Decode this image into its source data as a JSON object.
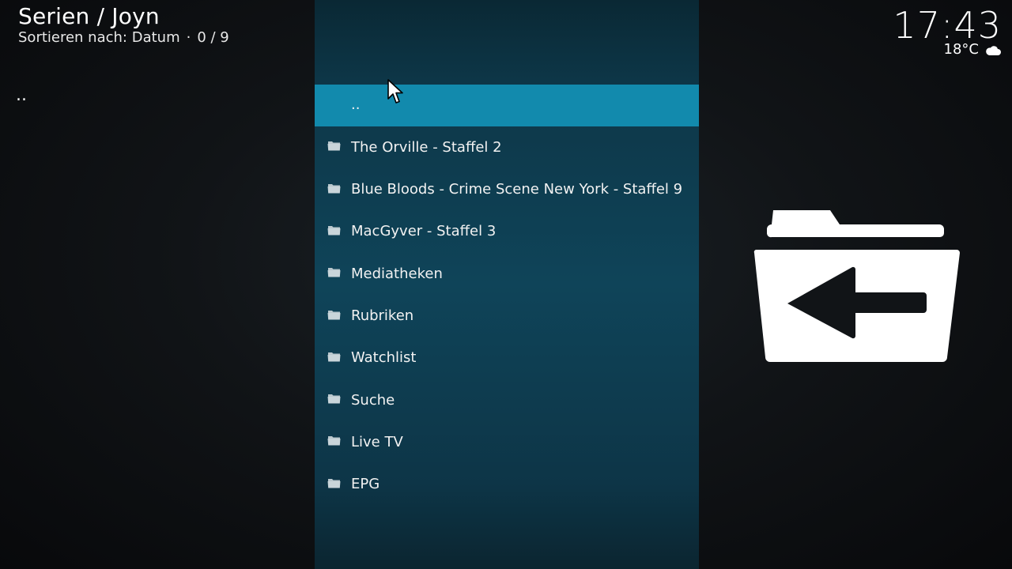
{
  "header": {
    "title": "Serien / Joyn",
    "sort_label": "Sortieren nach: Datum",
    "separator": "·",
    "counter": "0 / 9"
  },
  "clock": {
    "time": "17:43"
  },
  "weather": {
    "temperature": "18°C",
    "icon": "cloud-icon"
  },
  "side": {
    "up_dots": ".."
  },
  "list": {
    "focused_index": 0,
    "items": [
      {
        "label": "..",
        "icon": "parent-folder"
      },
      {
        "label": "The Orville - Staffel 2",
        "icon": "folder-icon"
      },
      {
        "label": "Blue Bloods - Crime Scene New York - Staffel 9",
        "icon": "folder-icon"
      },
      {
        "label": "MacGyver - Staffel 3",
        "icon": "folder-icon"
      },
      {
        "label": "Mediatheken",
        "icon": "folder-icon"
      },
      {
        "label": "Rubriken",
        "icon": "folder-icon"
      },
      {
        "label": "Watchlist",
        "icon": "folder-icon"
      },
      {
        "label": "Suche",
        "icon": "folder-icon"
      },
      {
        "label": "Live TV",
        "icon": "folder-icon"
      },
      {
        "label": "EPG",
        "icon": "folder-icon"
      }
    ]
  },
  "preview": {
    "icon": "folder-back-icon"
  },
  "colors": {
    "focus": "#128aad",
    "panel": "#0f4459",
    "background": "#111417"
  }
}
